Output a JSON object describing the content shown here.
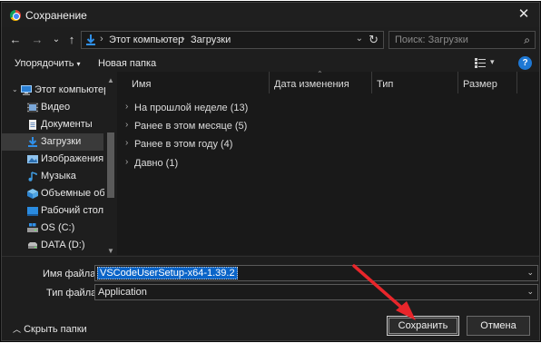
{
  "window": {
    "title": "Сохранение",
    "close_glyph": "✕"
  },
  "nav": {
    "back": "←",
    "forward": "→",
    "recent": "⌄",
    "up": "↑",
    "breadcrumb": [
      "Этот компьютер",
      "Загрузки"
    ],
    "refresh": "↻",
    "search_placeholder": "Поиск: Загрузки"
  },
  "toolbar": {
    "organize": "Упорядочить",
    "new_folder": "Новая папка",
    "help": "?"
  },
  "sidebar": {
    "items": [
      {
        "label": "Этот компьютер",
        "icon": "computer-icon"
      },
      {
        "label": "Видео",
        "icon": "video-icon"
      },
      {
        "label": "Документы",
        "icon": "documents-icon"
      },
      {
        "label": "Загрузки",
        "icon": "downloads-icon",
        "selected": true
      },
      {
        "label": "Изображения",
        "icon": "pictures-icon"
      },
      {
        "label": "Музыка",
        "icon": "music-icon"
      },
      {
        "label": "Объемные объ",
        "icon": "3d-objects-icon"
      },
      {
        "label": "Рабочий стол",
        "icon": "desktop-icon"
      },
      {
        "label": "OS (C:)",
        "icon": "windows-drive-icon"
      },
      {
        "label": "DATA (D:)",
        "icon": "drive-icon"
      }
    ]
  },
  "columns": [
    "Имя",
    "Дата изменения",
    "Тип",
    "Размер"
  ],
  "groups": [
    {
      "label": "На прошлой неделе (13)"
    },
    {
      "label": "Ранее в этом месяце (5)"
    },
    {
      "label": "Ранее в этом году (4)"
    },
    {
      "label": "Давно (1)"
    }
  ],
  "form": {
    "filename_label": "Имя файла:",
    "filename_value": "VSCodeUserSetup-x64-1.39.2",
    "filetype_label": "Тип файла:",
    "filetype_value": "Application"
  },
  "footer": {
    "hide_folders": "Скрыть папки",
    "save": "Сохранить",
    "cancel": "Отмена"
  },
  "colors": {
    "accent": "#0a64c8",
    "background": "#1e1e1e",
    "annotation_arrow": "#e8262b"
  }
}
